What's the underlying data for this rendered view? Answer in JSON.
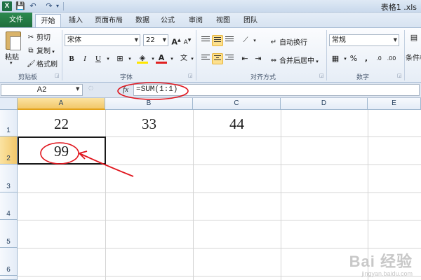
{
  "window": {
    "title": "表格1 .xls"
  },
  "quick_access": {
    "save_icon": "save-icon",
    "undo_icon": "undo-icon",
    "redo_icon": "redo-icon"
  },
  "tabs": [
    "文件",
    "开始",
    "插入",
    "页面布局",
    "数据",
    "公式",
    "审阅",
    "视图",
    "团队"
  ],
  "ribbon": {
    "clipboard": {
      "paste": "粘贴",
      "cut": "剪切",
      "copy": "复制",
      "format_painter": "格式刷",
      "label": "剪贴板"
    },
    "font": {
      "name": "宋体",
      "size": "22",
      "bold": "B",
      "italic": "I",
      "underline": "U",
      "grow": "A",
      "shrink": "A",
      "wen": "文",
      "label": "字体",
      "font_color": "#e02020",
      "fill_color": "#ffe600"
    },
    "alignment": {
      "wrap_text": "自动换行",
      "merge_center": "合并后居中",
      "label": "对齐方式"
    },
    "number": {
      "format": "常规",
      "percent": "%",
      "comma": ",",
      "label": "数字"
    },
    "styles": {
      "cond_format": "条件格"
    }
  },
  "formula_bar": {
    "name_box": "A2",
    "fx": "fx",
    "formula": "=SUM(1:1)"
  },
  "columns": [
    "A",
    "B",
    "C",
    "D",
    "E"
  ],
  "rows": [
    "1",
    "2",
    "3",
    "4",
    "5",
    "6"
  ],
  "cells": {
    "A1": "22",
    "B1": "33",
    "C1": "44",
    "A2": "99"
  },
  "annotation": {
    "color": "#e0141c"
  },
  "watermark": {
    "logo": "Bai 经验",
    "url": "jingyan.baidu.com"
  }
}
